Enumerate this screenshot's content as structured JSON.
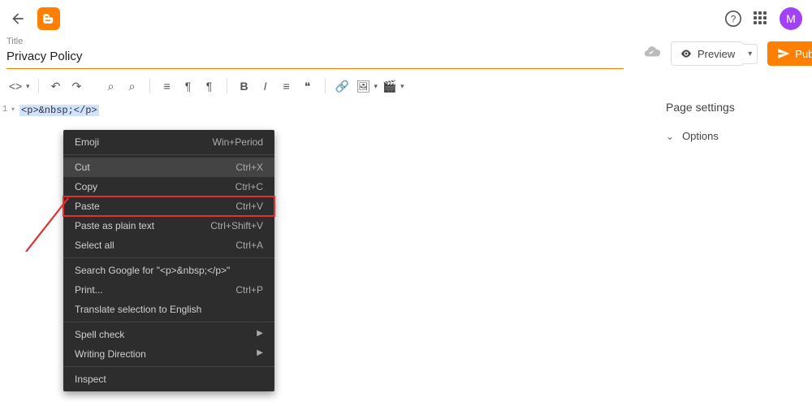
{
  "header": {
    "avatar_initial": "M"
  },
  "title": {
    "label": "Title",
    "value": "Privacy Policy"
  },
  "actions": {
    "preview": "Preview",
    "publish": "Publish"
  },
  "editor": {
    "line_number": "1",
    "code": "<p>&nbsp;</p>"
  },
  "context_menu": [
    {
      "label": "Emoji",
      "shortcut": "Win+Period"
    },
    {
      "sep": true
    },
    {
      "label": "Cut",
      "shortcut": "Ctrl+X",
      "hover": true
    },
    {
      "label": "Copy",
      "shortcut": "Ctrl+C"
    },
    {
      "label": "Paste",
      "shortcut": "Ctrl+V",
      "highlight": true
    },
    {
      "label": "Paste as plain text",
      "shortcut": "Ctrl+Shift+V"
    },
    {
      "label": "Select all",
      "shortcut": "Ctrl+A"
    },
    {
      "sep": true
    },
    {
      "label": "Search Google for \"<p>&nbsp;</p>\"",
      "shortcut": ""
    },
    {
      "label": "Print...",
      "shortcut": "Ctrl+P"
    },
    {
      "label": "Translate selection to English",
      "shortcut": ""
    },
    {
      "sep": true
    },
    {
      "label": "Spell check",
      "submenu": true
    },
    {
      "label": "Writing Direction",
      "submenu": true
    },
    {
      "sep": true
    },
    {
      "label": "Inspect",
      "shortcut": ""
    }
  ],
  "sidebar": {
    "heading": "Page settings",
    "items": [
      {
        "label": "Options"
      }
    ]
  }
}
